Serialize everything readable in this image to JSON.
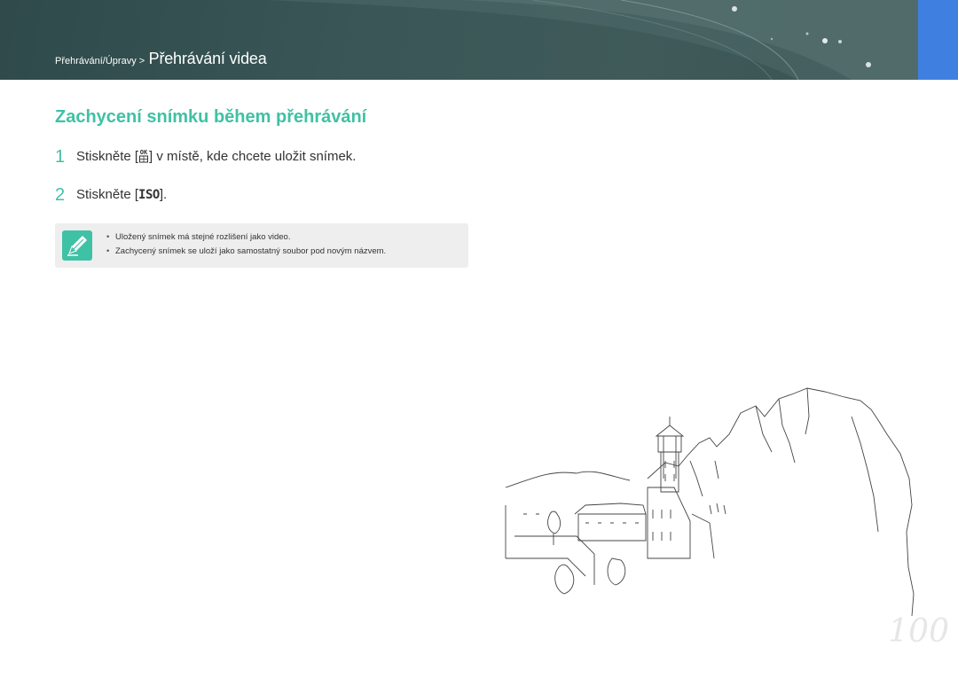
{
  "header": {
    "breadcrumb_parent": "Přehrávání/Úpravy >",
    "breadcrumb_current": "Přehrávání videa"
  },
  "section": {
    "title": "Zachycení snímku během přehrávání"
  },
  "steps": [
    {
      "number": "1",
      "text_before": "Stiskněte [",
      "text_after": "] v místě, kde chcete uložit snímek."
    },
    {
      "number": "2",
      "text_before": "Stiskněte [",
      "button": "ISO",
      "text_after": "]."
    }
  ],
  "note": {
    "icon": "pencil-note-icon",
    "items": [
      "Uložený snímek má stejné rozlišení jako video.",
      "Zachycený snímek se uloží jako samostatný soubor pod novým názvem."
    ]
  },
  "page_number": "100",
  "colors": {
    "accent": "#3fc1a5",
    "header": "#3a5656",
    "side_tab": "#3f7fe0"
  }
}
